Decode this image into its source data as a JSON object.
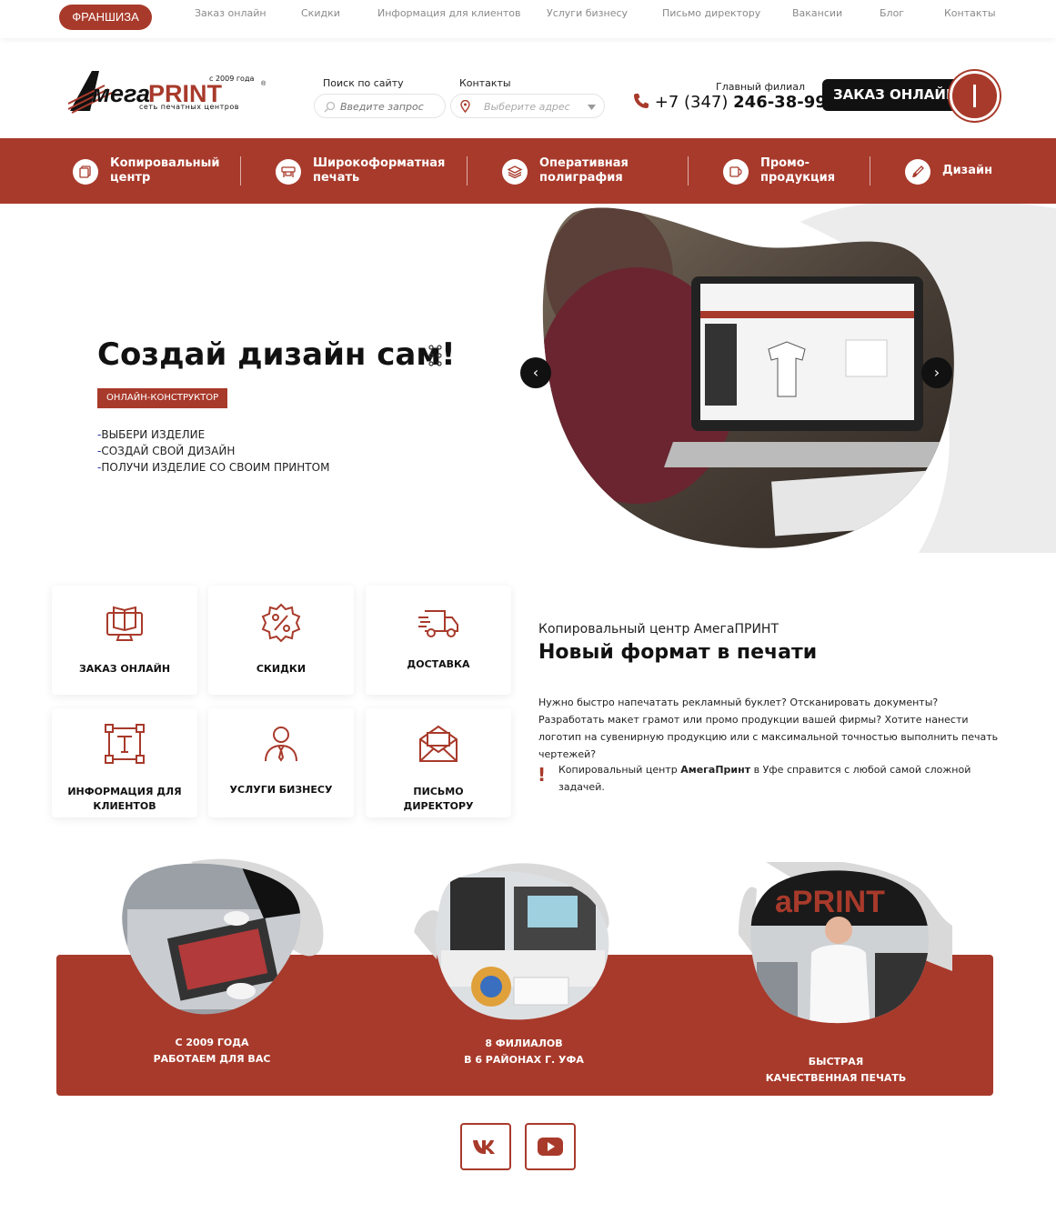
{
  "topbar": {
    "franchise": "ФРАНШИЗА",
    "links": [
      "Заказ онлайн",
      "Скидки",
      "Информация для клиентов",
      "Услуги бизнесу",
      "Письмо директору",
      "Вакансии",
      "Блог",
      "Контакты"
    ]
  },
  "header": {
    "logo_text": "АмегаPRINT",
    "logo_since": "с 2009 года",
    "logo_tagline": "сеть печатных центров",
    "search_label": "Поиск по сайту",
    "search_placeholder": "Введите запрос",
    "contacts_label": "Контакты",
    "address_placeholder": "Выберите адрес",
    "branch_label": "Главный филиал",
    "phone_prefix": "+7 (347)",
    "phone_number": "246-38-99",
    "order_button": "ЗАКАЗ ОНЛАЙН"
  },
  "nav": {
    "items": [
      {
        "label": "Копировальный\nцентр"
      },
      {
        "label": "Широкоформатная\nпечать"
      },
      {
        "label": "Оперативная\nполиграфия"
      },
      {
        "label": "Промо-\nпродукция"
      },
      {
        "label": "Дизайн"
      }
    ]
  },
  "hero": {
    "title": "Создай дизайн сам!",
    "badge": "ОНЛАЙН-КОНСТРУКТОР",
    "list": [
      "ВЫБЕРИ ИЗДЕЛИЕ",
      "СОЗДАЙ СВОЙ ДИЗАЙН",
      "ПОЛУЧИ ИЗДЕЛИЕ СО СВОИМ ПРИНТОМ"
    ],
    "prev": "‹",
    "next": "›"
  },
  "features": [
    {
      "label": "ЗАКАЗ ОНЛАЙН"
    },
    {
      "label": "СКИДКИ"
    },
    {
      "label": "ДОСТАВКА"
    },
    {
      "label": "ИНФОРМАЦИЯ ДЛЯ\nКЛИЕНТОВ"
    },
    {
      "label": "УСЛУГИ БИЗНЕСУ"
    },
    {
      "label": "ПИСЬМО\nДИРЕКТОРУ"
    }
  ],
  "intro": {
    "subtitle": "Копировальный центр АмегаПРИНТ",
    "title": "Новый формат в печати",
    "text": "Нужно быстро напечатать рекламный буклет? Отсканировать документы? Разработать макет грамот или промо продукции вашей фирмы? Хотите нанести логотип на сувенирную продукцию или с максимальной точностью выполнить печать чертежей?",
    "note_prefix": "Копировальный центр ",
    "note_brand": "АмегаПринт",
    "note_suffix": " в Уфе справится с любой самой сложной задачей.",
    "exclamation": "!"
  },
  "stats": [
    {
      "label": "С 2009 ГОДА\nРАБОТАЕМ ДЛЯ ВАС"
    },
    {
      "label": "8 ФИЛИАЛОВ\nВ 6 РАЙОНАХ Г. УФА"
    },
    {
      "label": "БЫСТРАЯ\nКАЧЕСТВЕННАЯ ПЕЧАТЬ"
    }
  ],
  "colors": {
    "brand": "#a83a2b",
    "dark": "#111111"
  }
}
